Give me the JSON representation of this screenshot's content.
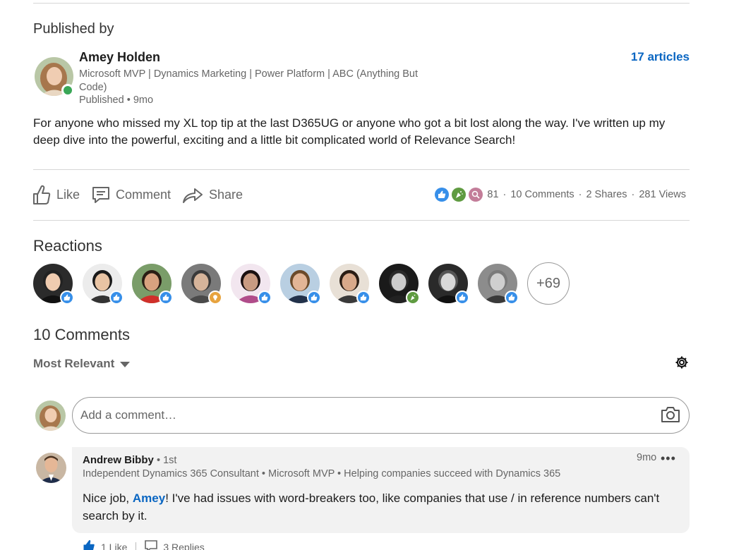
{
  "publisher": {
    "heading": "Published by",
    "name": "Amey Holden",
    "headline": "Microsoft MVP | Dynamics Marketing | Power Platform | ABC (Anything But Code)",
    "published": "Published • 9mo",
    "articles_link": "17 articles"
  },
  "post": {
    "text": "For anyone who missed my XL top tip at the last D365UG or anyone who got a bit lost along the way. I've written up my deep dive into the powerful, exciting and a little bit complicated world of Relevance Search!"
  },
  "actions": {
    "like": "Like",
    "comment": "Comment",
    "share": "Share"
  },
  "social": {
    "reaction_count": "81",
    "comments": "10 Comments",
    "shares": "2 Shares",
    "views": "281 Views",
    "separator": "·"
  },
  "reactions": {
    "heading": "Reactions",
    "more": "+69",
    "people": [
      {
        "type": "like",
        "skin": "#f0ccb0",
        "hair": "#222222",
        "bg": "#2b2b2b",
        "shirt": "#111111"
      },
      {
        "type": "like",
        "skin": "#e9c4a4",
        "hair": "#1a1a1a",
        "bg": "#ececec",
        "shirt": "#333333"
      },
      {
        "type": "like",
        "skin": "#d8a27f",
        "hair": "#2a1e14",
        "bg": "#7a9d69",
        "shirt": "#d0302a"
      },
      {
        "type": "insightful",
        "skin": "#d6b49a",
        "hair": "#3a3a3a",
        "bg": "#7a7a7a",
        "shirt": "#4a4a4a"
      },
      {
        "type": "like",
        "skin": "#c99b82",
        "hair": "#1a1010",
        "bg": "#f2e6ef",
        "shirt": "#b04c8a"
      },
      {
        "type": "like",
        "skin": "#e2b596",
        "hair": "#6b4a2a",
        "bg": "#b9cfe2",
        "shirt": "#22314a"
      },
      {
        "type": "like",
        "skin": "#d8a98a",
        "hair": "#2a1d14",
        "bg": "#e8e0d6",
        "shirt": "#3a3a3a"
      },
      {
        "type": "celebrate",
        "skin": "#cccccc",
        "hair": "#2a2a2a",
        "bg": "#1a1a1a",
        "shirt": "#222222"
      },
      {
        "type": "like",
        "skin": "#d9d9d9",
        "hair": "#555555",
        "bg": "#2a2a2a",
        "shirt": "#111111"
      },
      {
        "type": "like",
        "skin": "#cfcfcf",
        "hair": "#7a7a7a",
        "bg": "#8c8c8c",
        "shirt": "#3a3a3a"
      }
    ]
  },
  "comments_section": {
    "heading": "10 Comments",
    "sort_label": "Most Relevant",
    "input_placeholder": "Add a comment…"
  },
  "comment": {
    "name": "Andrew Bibby",
    "degree": "• 1st",
    "headline": "Independent Dynamics 365 Consultant • Microsoft MVP • Helping companies succeed with Dynamics 365",
    "time": "9mo",
    "more": "•••",
    "text_before": "Nice job, ",
    "mention": "Amey",
    "text_after": "! I've had issues with word-breakers too, like companies that use / in reference numbers can't search by it.",
    "likes": "1 Like",
    "replies": "3 Replies"
  },
  "colors": {
    "accent": "#0a66c2",
    "like": "#378fe9",
    "celebrate": "#5f9b41",
    "curious": "#c37d99",
    "insightful": "#e7a33e",
    "online": "#3aa757"
  }
}
